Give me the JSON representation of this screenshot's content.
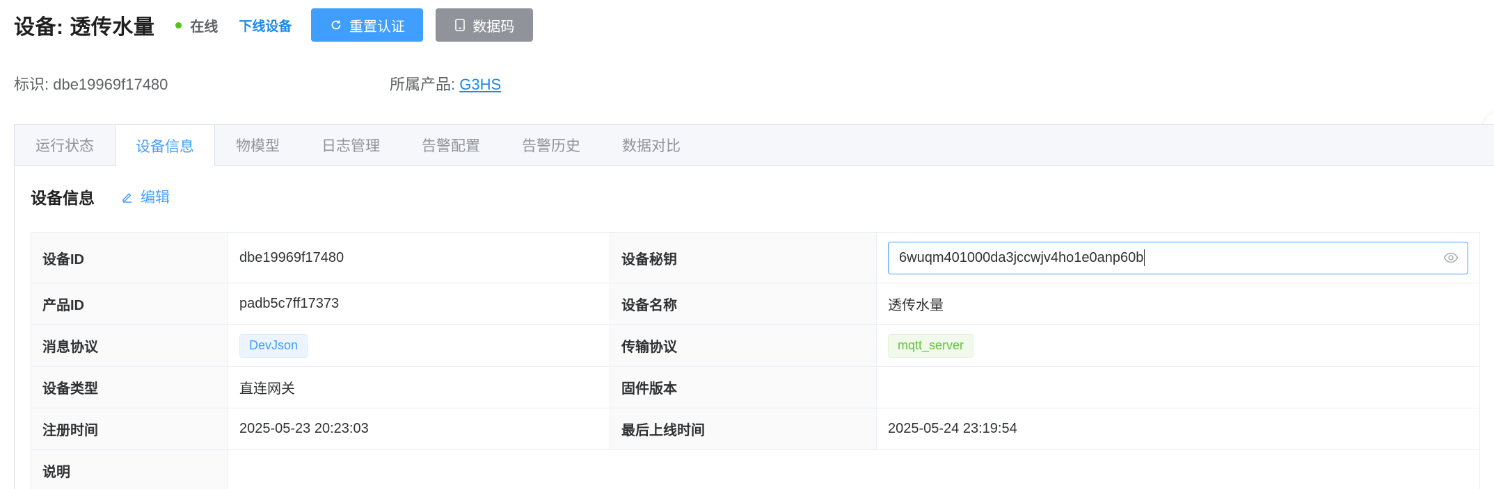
{
  "header": {
    "title": "设备: 透传水量",
    "status_text": "在线",
    "status_color": "#52c41a",
    "offline_link": "下线设备",
    "reset_button": "重置认证",
    "datacode_button": "数据码"
  },
  "meta": {
    "identifier": "标识: dbe19969f17480",
    "product_label": "所属产品: ",
    "product_value": "G3HS"
  },
  "tabs": [
    "运行状态",
    "设备信息",
    "物模型",
    "日志管理",
    "告警配置",
    "告警历史",
    "数据对比"
  ],
  "active_tab": "设备信息",
  "section": {
    "title": "设备信息",
    "edit_label": "编辑"
  },
  "fields": {
    "device_id_label": "设备ID",
    "device_id": "dbe19969f17480",
    "secret_label": "设备秘钥",
    "secret_value": "6wuqm401000da3jccwjv4ho1e0anp60b",
    "product_id_label": "产品ID",
    "product_id": "padb5c7ff17373",
    "device_name_label": "设备名称",
    "device_name": "透传水量",
    "msg_protocol_label": "消息协议",
    "msg_protocol": "DevJson",
    "transport_label": "传输协议",
    "transport": "mqtt_server",
    "device_type_label": "设备类型",
    "device_type": "直连网关",
    "firmware_label": "固件版本",
    "firmware": "",
    "register_label": "注册时间",
    "register_time": "2025-05-23 20:23:03",
    "last_online_label": "最后上线时间",
    "last_online": "2025-05-24 23:19:54",
    "desc_label": "说明",
    "desc": ""
  },
  "colors": {
    "primary": "#409eff",
    "link": "#1e88e5",
    "gray_button": "#909399"
  }
}
